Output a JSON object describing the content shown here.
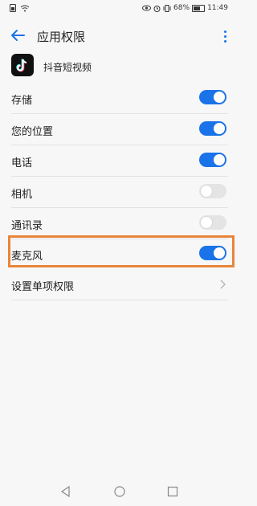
{
  "status": {
    "battery_percent": "68%",
    "time": "11:49"
  },
  "header": {
    "title": "应用权限"
  },
  "app": {
    "name": "抖音短视频"
  },
  "permissions": [
    {
      "label": "存储",
      "enabled": true
    },
    {
      "label": "您的位置",
      "enabled": true
    },
    {
      "label": "电话",
      "enabled": true
    },
    {
      "label": "相机",
      "enabled": false
    },
    {
      "label": "通讯录",
      "enabled": false
    },
    {
      "label": "麦克风",
      "enabled": true
    }
  ],
  "settings_item": {
    "label": "设置单项权限"
  },
  "colors": {
    "accent": "#1a73e8",
    "highlight_border": "#e9853a"
  }
}
